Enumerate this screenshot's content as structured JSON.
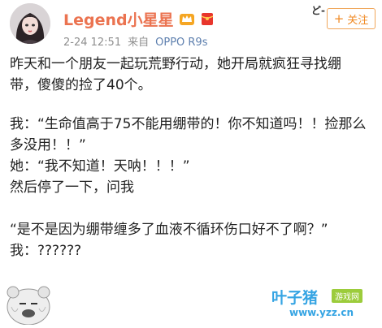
{
  "post": {
    "username": "Legend小星星",
    "timestamp": "2-24 12:51",
    "source_prefix": "来自",
    "device": "OPPO R9s",
    "follow_label": "关注",
    "follow_icon": "+"
  },
  "content": {
    "para1_line1": "昨天和一个朋友一起玩荒野行动，她开局就疯狂寻找绷",
    "para1_line2": "带，傻傻的捡了40个。",
    "para2_line1": "我：“生命值高于75不能用绷带的！你不知道吗！！捡那么",
    "para2_line2": "多没用！！”",
    "para2_line3": "她：“我不知道！天呐！！！”",
    "para2_line4": "然后停了一下，问我",
    "para3_line1": "“是不是因为绷带缠多了血液不循环伤口好不了啊？”",
    "para3_line2": "我：??????"
  },
  "sticker": {
    "text": "ど-"
  },
  "watermark": {
    "title": "叶子猪",
    "tag": "游戏网",
    "url": "www.yzz.cn"
  },
  "colors": {
    "username": "#eb7350",
    "meta": "#8f8f8f",
    "follow": "#f08a24",
    "watermark": "#35a4e3"
  }
}
